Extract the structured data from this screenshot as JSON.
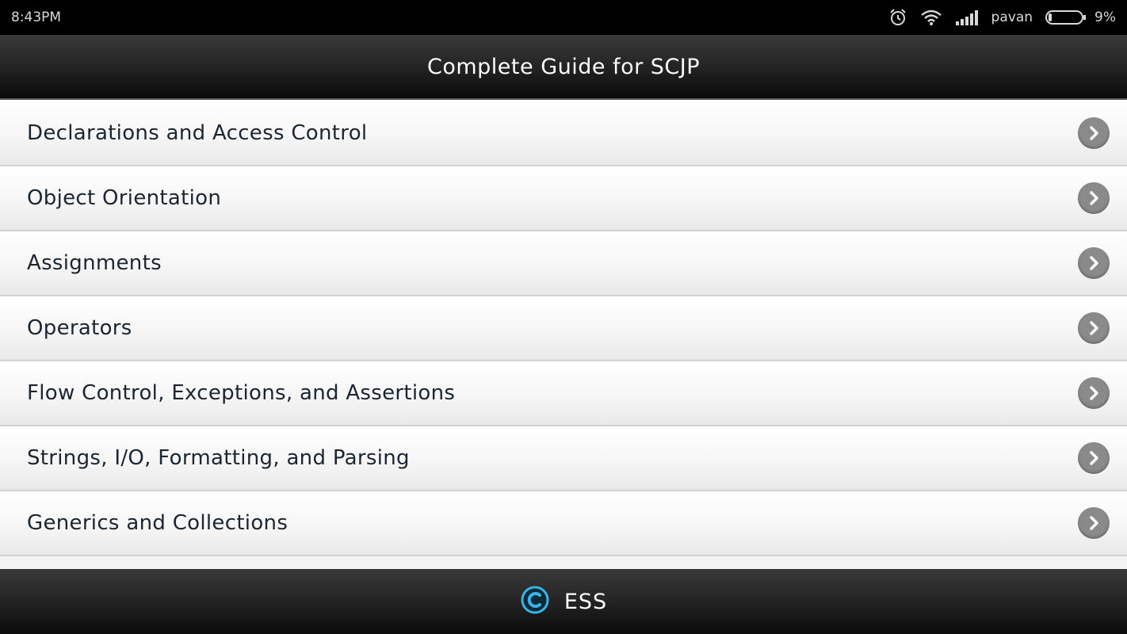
{
  "status_bar": {
    "time": "8:43PM",
    "carrier": "pavan",
    "battery": "9%",
    "icons": [
      "alarm-icon",
      "wifi-icon",
      "signal-icon",
      "battery-icon"
    ]
  },
  "header": {
    "title": "Complete Guide for SCJP"
  },
  "topics": [
    {
      "label": "Declarations and Access Control"
    },
    {
      "label": "Object Orientation"
    },
    {
      "label": "Assignments"
    },
    {
      "label": "Operators"
    },
    {
      "label": "Flow Control, Exceptions, and Assertions"
    },
    {
      "label": "Strings, I/O, Formatting, and Parsing"
    },
    {
      "label": "Generics and Collections"
    }
  ],
  "footer": {
    "brand": "ESS",
    "icon": "copyright-logo-icon"
  },
  "colors": {
    "bar_dark": "#111111",
    "text_dark": "#1c2630",
    "chevron_bg": "#8a8a8a",
    "logo_accent": "#3ab4e8"
  }
}
